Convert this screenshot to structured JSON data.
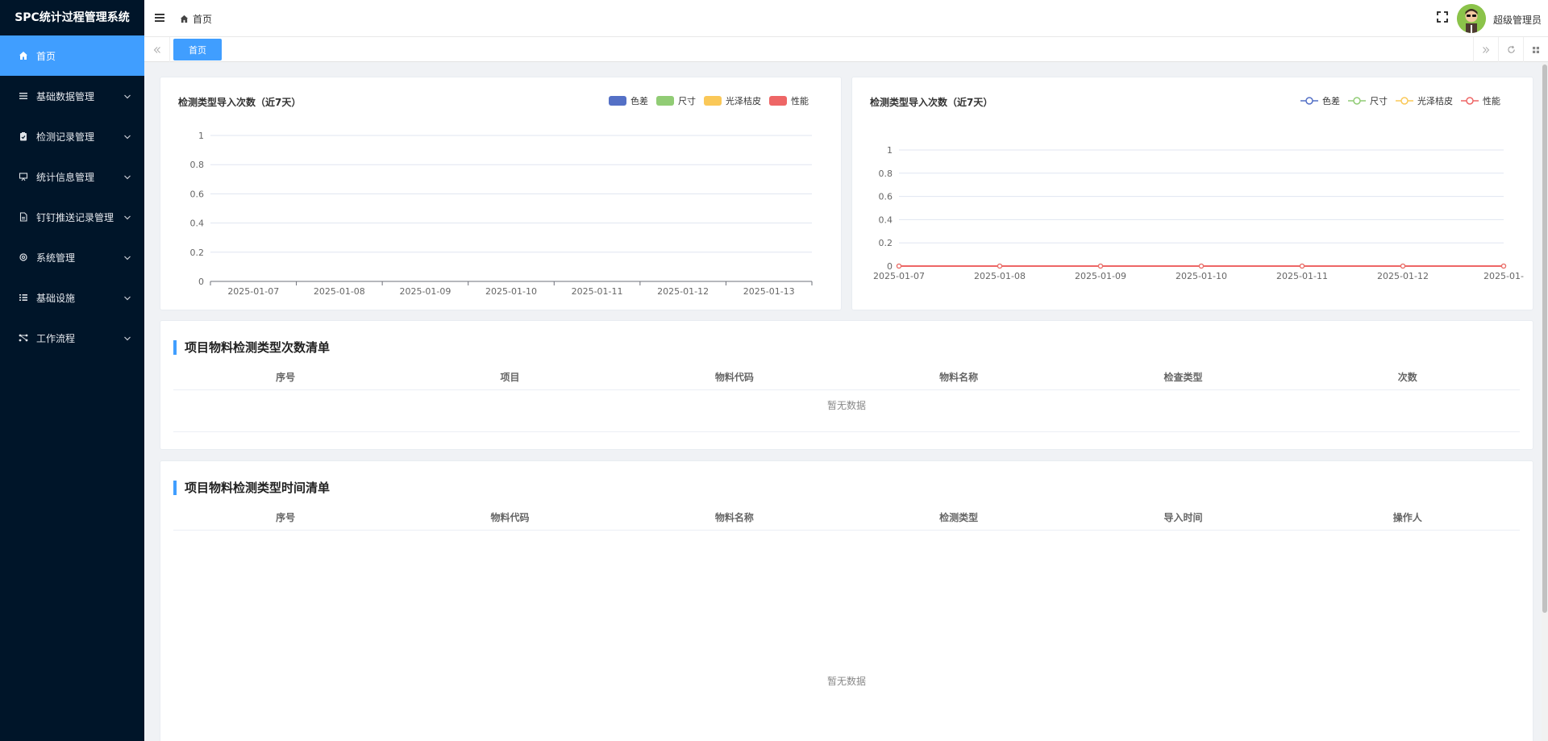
{
  "app": {
    "title": "SPC统计过程管理系统"
  },
  "sidebar": {
    "items": [
      {
        "label": "首页",
        "icon": "home-icon"
      },
      {
        "label": "基础数据管理",
        "icon": "list-icon"
      },
      {
        "label": "检测记录管理",
        "icon": "clipboard-icon"
      },
      {
        "label": "统计信息管理",
        "icon": "presentation-icon"
      },
      {
        "label": "钉钉推送记录管理",
        "icon": "document-icon"
      },
      {
        "label": "系统管理",
        "icon": "gear-icon"
      },
      {
        "label": "基础设施",
        "icon": "bullet-list-icon"
      },
      {
        "label": "工作流程",
        "icon": "flow-icon"
      }
    ]
  },
  "header": {
    "breadcrumb": "首页",
    "username": "超级管理员"
  },
  "tabs": {
    "home": "首页"
  },
  "colors": {
    "accent": "#409eff",
    "sidebar_bg": "#001529",
    "series": [
      "#5470c6",
      "#91cc75",
      "#fac858",
      "#ee6666"
    ]
  },
  "chart_data": [
    {
      "type": "bar",
      "title": "检测类型导入次数（近7天）",
      "categories": [
        "2025-01-07",
        "2025-01-08",
        "2025-01-09",
        "2025-01-10",
        "2025-01-11",
        "2025-01-12",
        "2025-01-13"
      ],
      "series": [
        {
          "name": "色差",
          "values": [
            0,
            0,
            0,
            0,
            0,
            0,
            0
          ]
        },
        {
          "name": "尺寸",
          "values": [
            0,
            0,
            0,
            0,
            0,
            0,
            0
          ]
        },
        {
          "name": "光泽桔皮",
          "values": [
            0,
            0,
            0,
            0,
            0,
            0,
            0
          ]
        },
        {
          "name": "性能",
          "values": [
            0,
            0,
            0,
            0,
            0,
            0,
            0
          ]
        }
      ],
      "yticks": [
        "0",
        "0.2",
        "0.4",
        "0.6",
        "0.8",
        "1"
      ],
      "ylim": [
        0,
        1
      ],
      "grid": true,
      "legend": "top-right"
    },
    {
      "type": "line",
      "title": "检测类型导入次数（近7天）",
      "categories": [
        "2025-01-07",
        "2025-01-08",
        "2025-01-09",
        "2025-01-10",
        "2025-01-11",
        "2025-01-12",
        "2025-01-"
      ],
      "series": [
        {
          "name": "色差",
          "values": [
            0,
            0,
            0,
            0,
            0,
            0,
            0
          ]
        },
        {
          "name": "尺寸",
          "values": [
            0,
            0,
            0,
            0,
            0,
            0,
            0
          ]
        },
        {
          "name": "光泽桔皮",
          "values": [
            0,
            0,
            0,
            0,
            0,
            0,
            0
          ]
        },
        {
          "name": "性能",
          "values": [
            0,
            0,
            0,
            0,
            0,
            0,
            0
          ]
        }
      ],
      "yticks": [
        "0",
        "0.2",
        "0.4",
        "0.6",
        "0.8",
        "1"
      ],
      "ylim": [
        0,
        1
      ],
      "grid": true,
      "legend": "top-right"
    }
  ],
  "table1": {
    "title": "项目物料检测类型次数清单",
    "columns": [
      "序号",
      "项目",
      "物料代码",
      "物料名称",
      "检查类型",
      "次数"
    ],
    "empty": "暂无数据"
  },
  "table2": {
    "title": "项目物料检测类型时间清单",
    "columns": [
      "序号",
      "物料代码",
      "物料名称",
      "检测类型",
      "导入时间",
      "操作人"
    ],
    "empty": "暂无数据"
  }
}
